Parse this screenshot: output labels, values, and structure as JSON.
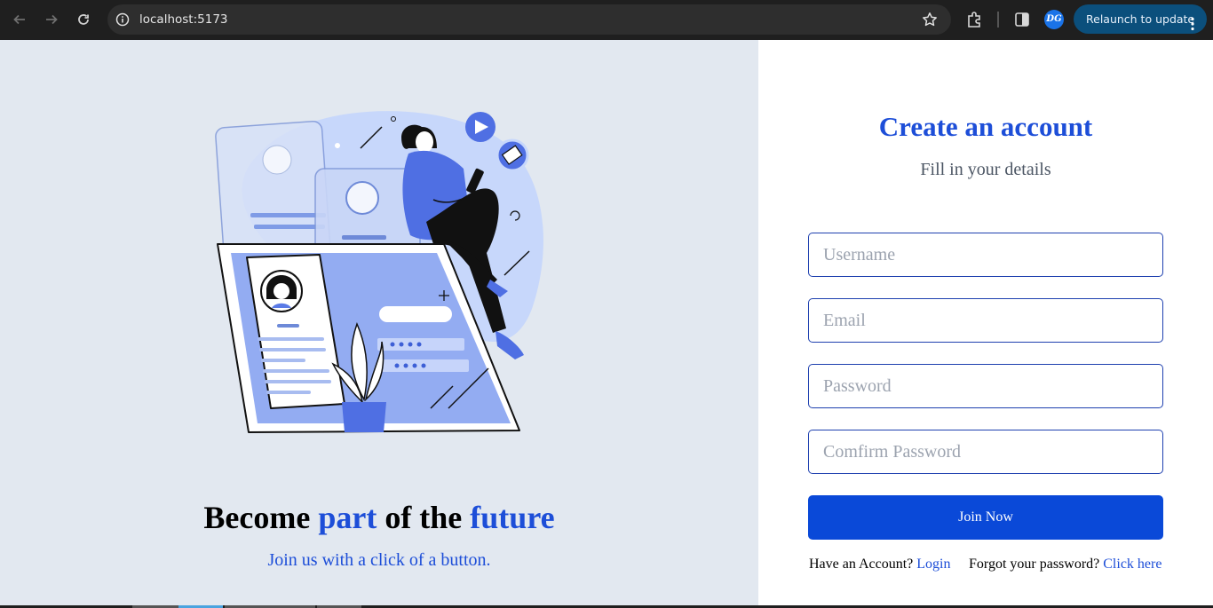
{
  "browser": {
    "url": "localhost:5173",
    "relaunch_label": "Relaunch to update",
    "profile_initials": "DG",
    "icons": [
      "back-arrow-icon",
      "forward-arrow-icon",
      "reload-icon",
      "site-info-icon",
      "star-icon",
      "extensions-icon",
      "side-panel-icon",
      "more-vert-icon"
    ]
  },
  "hero": {
    "headline_parts": [
      "Become ",
      "part",
      " of the ",
      "future"
    ],
    "tagline": "Join us with a click of a button."
  },
  "form": {
    "title": "Create an account",
    "subtitle": "Fill in your details",
    "username_placeholder": "Username",
    "email_placeholder": "Email",
    "password_placeholder": "Password",
    "confirm_placeholder": "Comfirm Password",
    "submit_label": "Join Now",
    "have_account_text": "Have an Account?",
    "login_link": "Login",
    "forgot_text": "Forgot your password?",
    "click_here_link": "Click here"
  },
  "colors": {
    "accent": "#1d4ed8",
    "button": "#0a49d8",
    "left_bg": "#e2e8f0"
  }
}
